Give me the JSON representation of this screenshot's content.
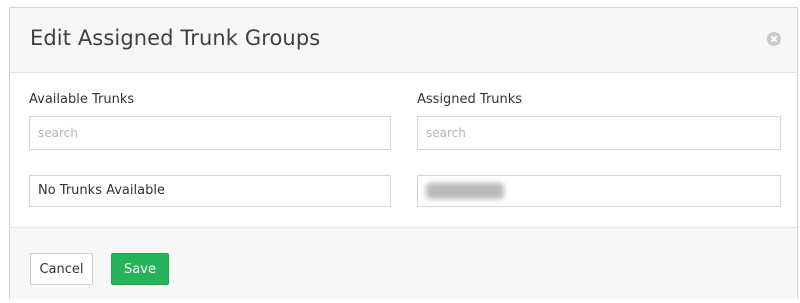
{
  "dialog": {
    "title": "Edit Assigned Trunk Groups",
    "close_icon": "close-circle-icon"
  },
  "available": {
    "label": "Available Trunks",
    "search_placeholder": "search",
    "empty_message": "No Trunks Available"
  },
  "assigned": {
    "label": "Assigned Trunks",
    "search_placeholder": "search"
  },
  "footer": {
    "cancel_label": "Cancel",
    "save_label": "Save"
  },
  "colors": {
    "save_button": "#27b35a",
    "header_background": "#f7f7f7"
  }
}
